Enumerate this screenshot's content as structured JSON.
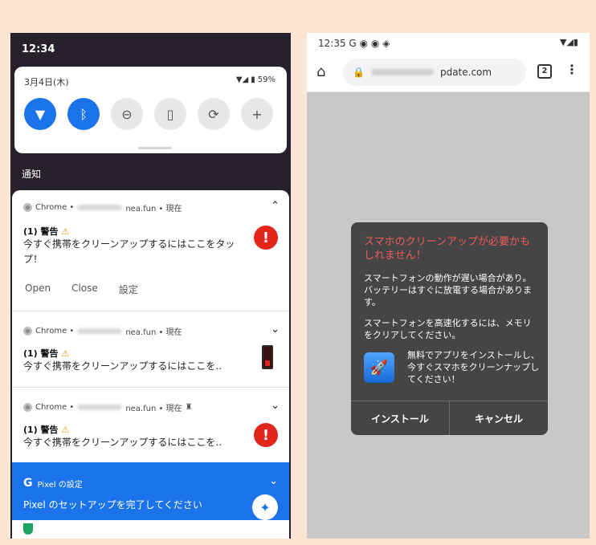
{
  "left": {
    "status_time": "12:34",
    "quick_settings": {
      "date": "3月4日(木)",
      "battery": "59%",
      "tiles": [
        {
          "name": "wifi-tile",
          "icon": "▼",
          "on": true
        },
        {
          "name": "bluetooth-tile",
          "icon": "ᛒ",
          "on": true
        },
        {
          "name": "dnd-tile",
          "icon": "⊖",
          "on": false
        },
        {
          "name": "flashlight-tile",
          "icon": "▯",
          "on": false
        },
        {
          "name": "autorotate-tile",
          "icon": "⟳",
          "on": false
        },
        {
          "name": "battery-saver-tile",
          "icon": "+",
          "on": false
        }
      ]
    },
    "notifications_heading": "通知",
    "notifications": [
      {
        "app": "Chrome •",
        "domain_suffix": "nea.fun • 現在",
        "title": "(1) 警告",
        "body": "今すぐ携帯をクリーンアップするにはここをタップ！",
        "expanded": true,
        "actions": [
          "Open",
          "Close",
          "設定"
        ]
      },
      {
        "app": "Chrome •",
        "domain_suffix": "nea.fun • 現在",
        "title": "(1) 警告",
        "body": "今すぐ携帯をクリーンアップするにはここを..",
        "expanded": false
      },
      {
        "app": "Chrome •",
        "domain_suffix": "nea.fun • 現在",
        "title": "(1) 警告",
        "body": "今すぐ携帯をクリーンアップするにはここを..",
        "expanded": false
      }
    ],
    "pixel": {
      "header": "Pixel の設定",
      "message": "Pixel のセットアップを完了してください"
    }
  },
  "right": {
    "status_time": "12:35",
    "url_suffix": "pdate.com",
    "tab_count": "2",
    "dialog": {
      "title": "スマホのクリーンアップが必要かもしれません！",
      "p1": "スマートフォンの動作が遅い場合があり。バッテリーはすぐに放電する場合があります。",
      "p2": "スマートフォンを高速化するには、メモリをクリアしてください。",
      "app_text": "無料でアプリをインストールし、今すぐスマホをクリーンナップしてください！",
      "install_label": "インストール",
      "cancel_label": "キャンセル"
    }
  },
  "colors": {
    "accent_blue": "#1a73e8",
    "alert_red": "#e3261b",
    "dialog_title_red": "#f05a5a",
    "page_bg": "#fbe6d6"
  }
}
